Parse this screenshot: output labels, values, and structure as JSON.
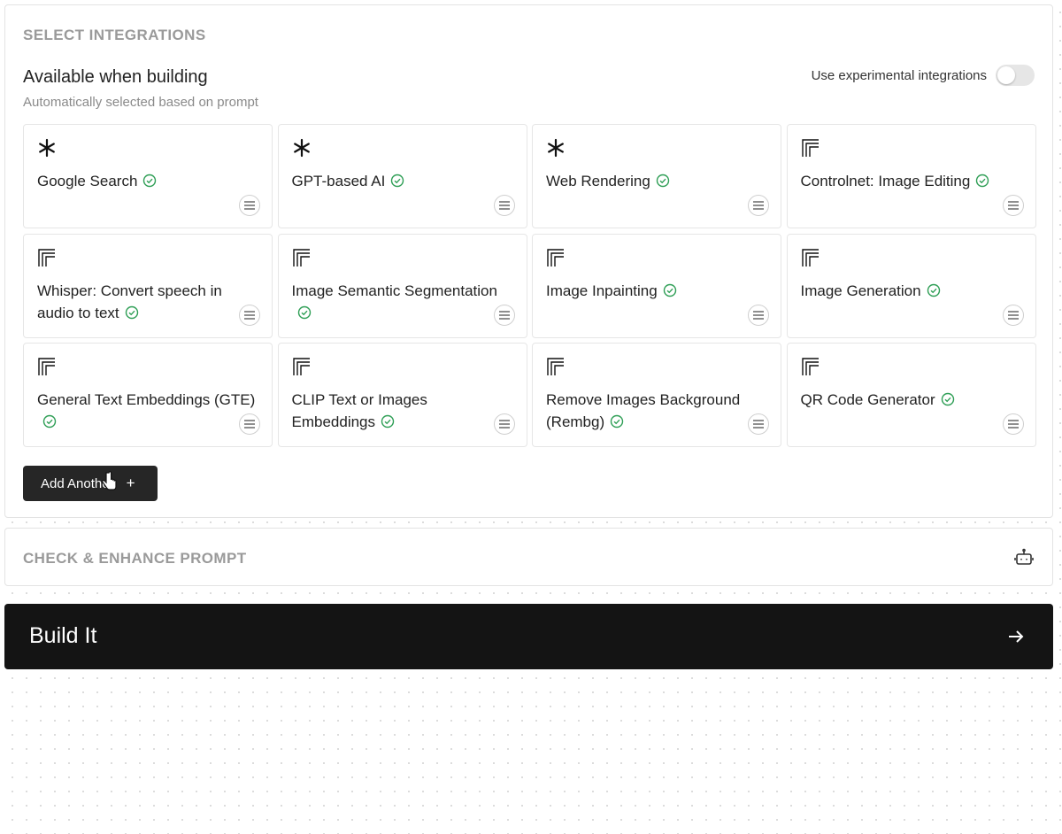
{
  "integrations": {
    "section_title": "SELECT INTEGRATIONS",
    "available_title": "Available when building",
    "available_subtitle": "Automatically selected based on prompt",
    "experimental_toggle_label": "Use experimental integrations",
    "experimental_enabled": false,
    "cards": [
      {
        "label": "Google Search",
        "icon": "asterisk-icon",
        "selected": true
      },
      {
        "label": "GPT-based AI",
        "icon": "asterisk-icon",
        "selected": true
      },
      {
        "label": "Web Rendering",
        "icon": "asterisk-icon",
        "selected": true
      },
      {
        "label": "Controlnet: Image Editing",
        "icon": "replicate-icon",
        "selected": true
      },
      {
        "label": "Whisper: Convert speech in audio to text",
        "icon": "replicate-icon",
        "selected": true
      },
      {
        "label": "Image Semantic Segmentation",
        "icon": "replicate-icon",
        "selected": true
      },
      {
        "label": "Image Inpainting",
        "icon": "replicate-icon",
        "selected": true
      },
      {
        "label": "Image Generation",
        "icon": "replicate-icon",
        "selected": true
      },
      {
        "label": "General Text Embeddings (GTE)",
        "icon": "replicate-icon",
        "selected": true
      },
      {
        "label": "CLIP Text or Images Embeddings",
        "icon": "replicate-icon",
        "selected": true
      },
      {
        "label": "Remove Images Background (Rembg)",
        "icon": "replicate-icon",
        "selected": true
      },
      {
        "label": "QR Code Generator",
        "icon": "replicate-icon",
        "selected": true
      }
    ],
    "add_button_label": "Add Another",
    "add_button_icon": "plus-icon"
  },
  "enhance": {
    "section_title": "CHECK & ENHANCE PROMPT",
    "icon": "robot-icon"
  },
  "build": {
    "label": "Build It",
    "icon": "arrow-right-icon"
  },
  "colors": {
    "accent_dark": "#141414",
    "check_green": "#2e9e55",
    "section_title_gray": "#9a9a9a"
  }
}
